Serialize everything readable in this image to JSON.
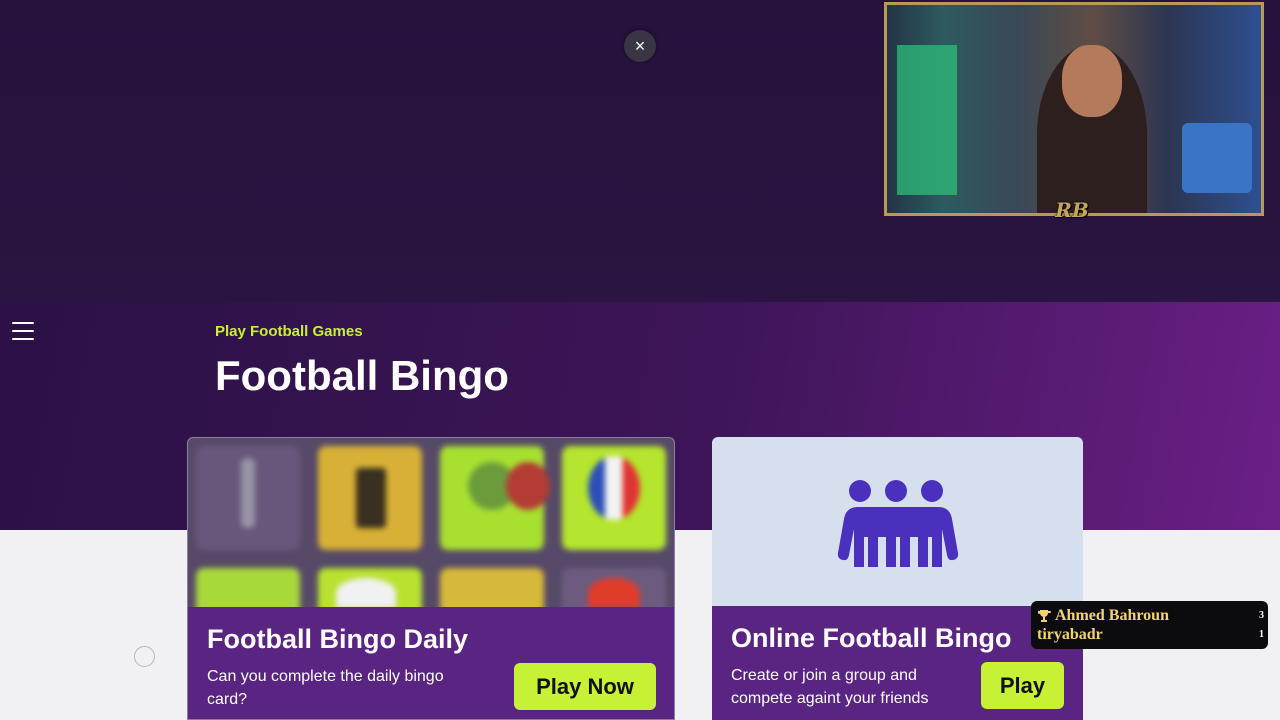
{
  "ad": {
    "close_glyph": "×"
  },
  "header": {
    "menu_icon": "hamburger-icon",
    "kicker": "Play Football Games",
    "title": "Football Bingo"
  },
  "cards": [
    {
      "title": "Football Bingo Daily",
      "description": "Can you complete the daily bingo card?",
      "button": "Play Now"
    },
    {
      "title": "Online Football Bingo",
      "description": "Create or join a group and compete againt your friends",
      "button": "Play",
      "icon": "group-people-icon",
      "icon_color": "#4b2fbd"
    }
  ],
  "colors": {
    "accent": "#c6f135",
    "card_footer": "#5a2482",
    "hero_bg": "#3d1558"
  },
  "stream": {
    "webcam_logo": "RB",
    "leaderboard": [
      {
        "name": "Ahmed Bahroun",
        "score": "3",
        "icon": "trophy-icon"
      },
      {
        "name": "tiryabadr",
        "score": "1"
      }
    ]
  }
}
